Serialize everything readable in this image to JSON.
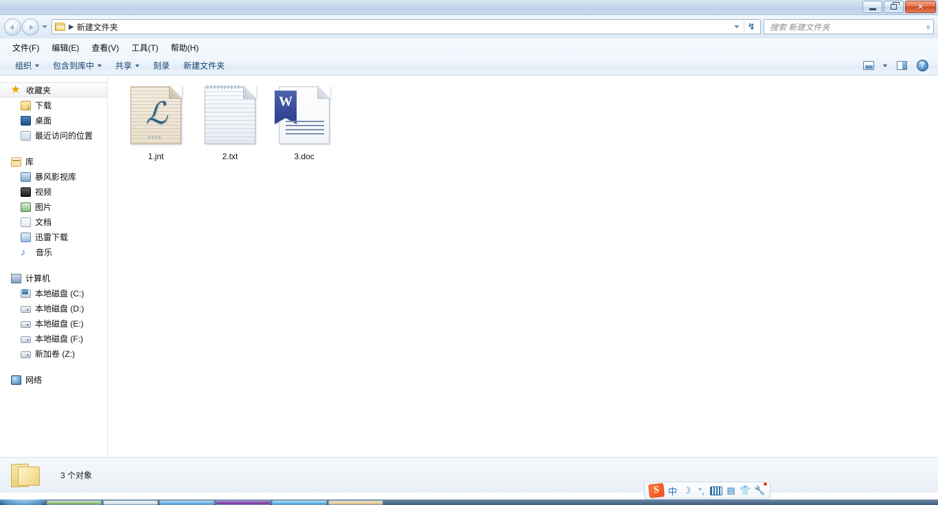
{
  "window": {
    "controls": [
      {
        "name": "minimize",
        "label": "—"
      },
      {
        "name": "maximize",
        "label": "❐"
      },
      {
        "name": "close",
        "label": "✕"
      }
    ]
  },
  "address": {
    "folder_icon": "folder-icon",
    "separator": "▶",
    "breadcrumb": "新建文件夹",
    "dropdown_icon": "chevron-down-icon",
    "refresh_icon": "refresh-icon",
    "refresh_glyph": "↯"
  },
  "search": {
    "placeholder": "搜索 新建文件夹",
    "icon": "search-icon",
    "glyph": "⌕"
  },
  "menubar": {
    "items": [
      {
        "label": "文件(F)",
        "name": "menu-file"
      },
      {
        "label": "编辑(E)",
        "name": "menu-edit"
      },
      {
        "label": "查看(V)",
        "name": "menu-view"
      },
      {
        "label": "工具(T)",
        "name": "menu-tools"
      },
      {
        "label": "帮助(H)",
        "name": "menu-help"
      }
    ]
  },
  "toolbar": {
    "organize": "组织",
    "include_in_library": "包含到库中",
    "share": "共享",
    "burn": "刻录",
    "new_folder": "新建文件夹",
    "views_icon": "views-icon",
    "preview_pane_icon": "preview-pane-icon",
    "help_icon": "help-icon",
    "help_glyph": "?"
  },
  "sidebar": {
    "favorites": {
      "title": "收藏夹",
      "icon": "star-icon",
      "glyph": "★",
      "items": [
        {
          "label": "下载",
          "icon": "downloads-icon"
        },
        {
          "label": "桌面",
          "icon": "desktop-icon"
        },
        {
          "label": "最近访问的位置",
          "icon": "recent-places-icon"
        }
      ]
    },
    "libraries": {
      "title": "库",
      "icon": "library-icon",
      "items": [
        {
          "label": "暴风影视库",
          "icon": "baofeng-library-icon"
        },
        {
          "label": "视频",
          "icon": "videos-icon"
        },
        {
          "label": "图片",
          "icon": "pictures-icon"
        },
        {
          "label": "文档",
          "icon": "documents-icon"
        },
        {
          "label": "迅雷下载",
          "icon": "thunder-download-icon"
        },
        {
          "label": "音乐",
          "icon": "music-icon",
          "glyph": "♪"
        }
      ]
    },
    "computer": {
      "title": "计算机",
      "icon": "computer-icon",
      "items": [
        {
          "label": "本地磁盘 (C:)",
          "icon": "system-drive-icon"
        },
        {
          "label": "本地磁盘 (D:)",
          "icon": "drive-icon"
        },
        {
          "label": "本地磁盘 (E:)",
          "icon": "drive-icon"
        },
        {
          "label": "本地磁盘 (F:)",
          "icon": "drive-icon"
        },
        {
          "label": "新加卷 (Z:)",
          "icon": "drive-icon"
        }
      ]
    },
    "network": {
      "title": "网络",
      "icon": "network-icon"
    }
  },
  "files": [
    {
      "name": "1.jnt",
      "type": "jnt"
    },
    {
      "name": "2.txt",
      "type": "txt"
    },
    {
      "name": "3.doc",
      "type": "doc"
    }
  ],
  "statusbar": {
    "folder_icon": "folder-icon",
    "item_count": "3 个对象"
  },
  "tray": {
    "ime": [
      {
        "name": "sogou-logo-icon",
        "glyph": "S"
      },
      {
        "name": "chinese-mode-icon",
        "glyph": "中"
      },
      {
        "name": "moon-icon",
        "glyph": "☽"
      },
      {
        "name": "punctuation-icon",
        "glyph": "°,"
      },
      {
        "name": "soft-keyboard-icon",
        "glyph": ""
      },
      {
        "name": "user-card-icon",
        "glyph": "▤"
      },
      {
        "name": "skin-icon",
        "glyph": "👕"
      },
      {
        "name": "tools-icon",
        "glyph": "🔧"
      }
    ]
  },
  "colors": {
    "accent": "#2a6ca8",
    "titlebar": "#c8dbee",
    "close_button": "#cf4a22",
    "folder_yellow": "#f0c75a",
    "word_blue": "#2f4392"
  }
}
